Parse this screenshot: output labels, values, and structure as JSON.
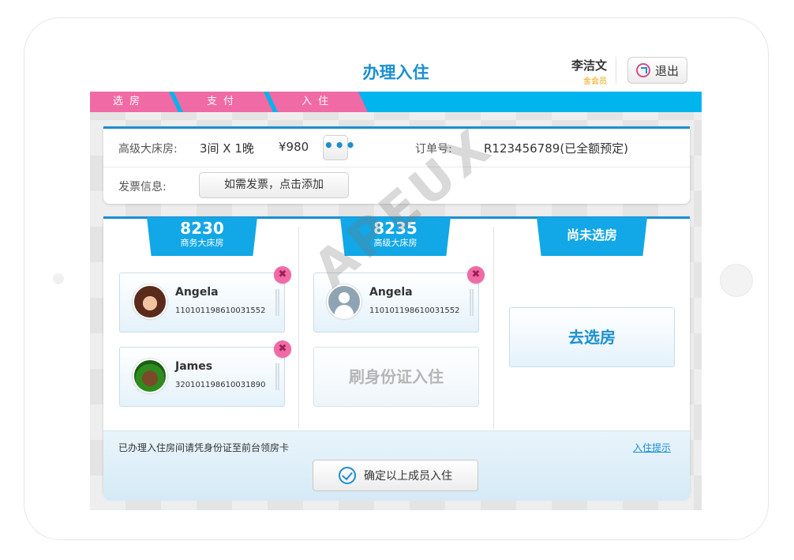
{
  "header": {
    "title": "办理入住",
    "user_name": "李洁文",
    "user_level": "金会员",
    "logout_label": "退出"
  },
  "steps": [
    "选房",
    "支付",
    "入住"
  ],
  "colors": {
    "primary": "#1a8fd1",
    "accent_pink": "#f06aa5",
    "step_bar": "#00b4ee",
    "member_gold": "#f0a000"
  },
  "order": {
    "room_label": "高级大床房:",
    "room_detail": "3间 X 1晚",
    "price": "¥980",
    "more_label": "•••",
    "order_label": "订单号:",
    "order_value": "R123456789(已全额预定)",
    "invoice_label": "发票信息:",
    "invoice_button": "如需发票，点击添加"
  },
  "rooms": [
    {
      "number": "8230",
      "type": "商务大床房",
      "guests": [
        {
          "name": "Angela",
          "id": "110101198610031552",
          "avatar": "female-photo-avatar"
        },
        {
          "name": "James",
          "id": "320101198610031890",
          "avatar": "male-photo-avatar"
        }
      ]
    },
    {
      "number": "8235",
      "type": "高级大床房",
      "guests": [
        {
          "name": "Angela",
          "id": "110101198610031552",
          "avatar": "placeholder-person-avatar"
        }
      ],
      "id_slot_label": "刷身份证入住"
    },
    {
      "label": "尚未选房",
      "goto_label": "去选房"
    }
  ],
  "footer": {
    "notice": "已办理入住房间请凭身份证至前台领房卡",
    "tips_link": "入住提示",
    "confirm_label": "确定以上成员入住"
  },
  "watermark": "APEUX"
}
